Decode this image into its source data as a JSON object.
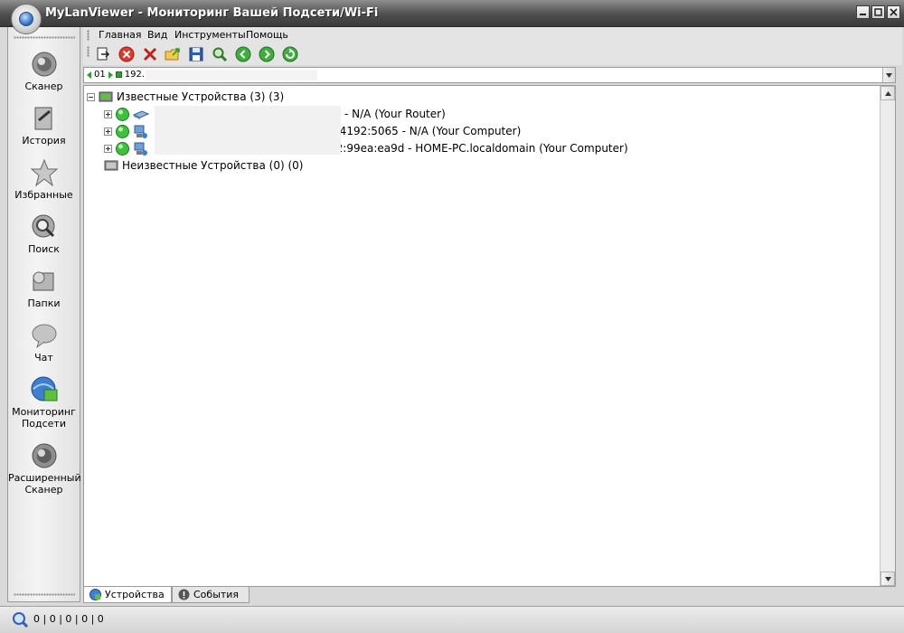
{
  "window": {
    "title": "MyLanViewer - Мониторинг Вашей Подсети/Wi-Fi"
  },
  "sidebar": {
    "items": [
      {
        "label": "Сканер",
        "icon": "scanner-icon"
      },
      {
        "label": "История",
        "icon": "history-icon"
      },
      {
        "label": "Избранные",
        "icon": "favorites-star-icon"
      },
      {
        "label": "Поиск",
        "icon": "search-icon"
      },
      {
        "label": "Папки",
        "icon": "folders-icon"
      },
      {
        "label": "Чат",
        "icon": "chat-icon"
      },
      {
        "label": "Мониторинг",
        "label2": "Подсети",
        "icon": "subnet-monitoring-icon"
      },
      {
        "label": "Расширенный",
        "label2": "Сканер",
        "icon": "advanced-scanner-icon"
      }
    ]
  },
  "menu": {
    "items": [
      "Главная",
      "Вид",
      "Инструменты",
      "Помощь"
    ]
  },
  "toolbar": {
    "buttons": [
      "export-icon",
      "stop-icon",
      "delete-icon",
      "open-folder-icon",
      "save-icon",
      "find-icon",
      "back-icon",
      "forward-icon",
      "refresh-icon"
    ]
  },
  "address": {
    "prefix": "01",
    "value": "192."
  },
  "tree": {
    "known_label": "Известные Устройства (3) (3)",
    "unknown_label": "Неизвестные Устройства (0) (0)",
    "devices": [
      {
        "text": "- N/A (Your Router)",
        "type": "router"
      },
      {
        "text": "0:4192:5065 - N/A (Your Computer)",
        "type": "computer"
      },
      {
        "text": "52:99ea:ea9d - HOME-PC.localdomain (Your Computer)",
        "type": "computer"
      }
    ]
  },
  "tabs": {
    "devices": "Устройства",
    "events": "События"
  },
  "status": {
    "text": "0 | 0 | 0 | 0 | 0"
  },
  "colors": {
    "titlebar": "#4e4e4e",
    "online": "#3cc23c"
  }
}
